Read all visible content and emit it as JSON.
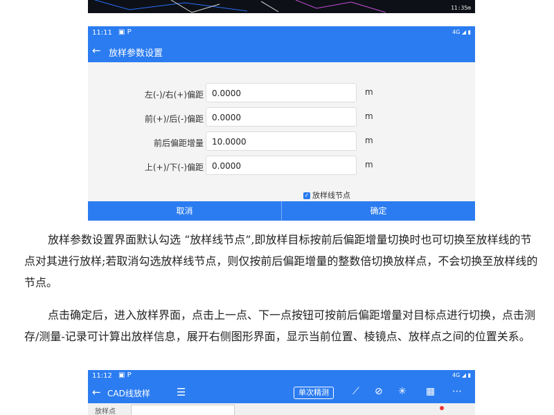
{
  "top_screenshot": {
    "scale_text": "11:35m"
  },
  "screen1": {
    "status_time": "11:11",
    "status_icons": "▣ P",
    "status_right": "4G ◢ ▮",
    "title": "放样参数设置",
    "fields": [
      {
        "label": "左(-)/右(+)偏距",
        "value": "0.0000",
        "unit": "m"
      },
      {
        "label": "前(+)/后(-)偏距",
        "value": "0.0000",
        "unit": "m"
      },
      {
        "label": "前后偏距增量",
        "value": "10.0000",
        "unit": "m"
      },
      {
        "label": "上(+)/下(-)偏距",
        "value": "0.0000",
        "unit": "m"
      }
    ],
    "checkbox_label": "放样线节点",
    "checkbox_checked": true,
    "cancel_label": "取消",
    "ok_label": "确定"
  },
  "paragraphs": [
    "放样参数设置界面默认勾选 “放样线节点”,即放样目标按前后偏距增量切换时也可切换至放样线的节点对其进行放样;若取消勾选放样线节点，则仅按前后偏距增量的整数倍切换放样点，不会切换至放样线的节点。",
    "点击确定后，进入放样界面，点击上一点、下一点按钮可按前后偏距增量对目标点进行切换，点击测存/测量-记录可计算出放样信息，展开右侧图形界面，显示当前位置、棱镜点、放样点之间的位置关系。"
  ],
  "screen2": {
    "status_time": "11:12",
    "status_icons": "▣ P",
    "status_right": "4G ◢ ▮",
    "title": "CAD线放样",
    "mode_button": "单次精测",
    "toolbar_icons": [
      "menu-icon",
      "survey-icon",
      "no-signal-icon",
      "star-icon",
      "table-icon",
      "more-icon"
    ],
    "row_label": "放样点"
  },
  "colors": {
    "accent": "#2b7cf0"
  }
}
